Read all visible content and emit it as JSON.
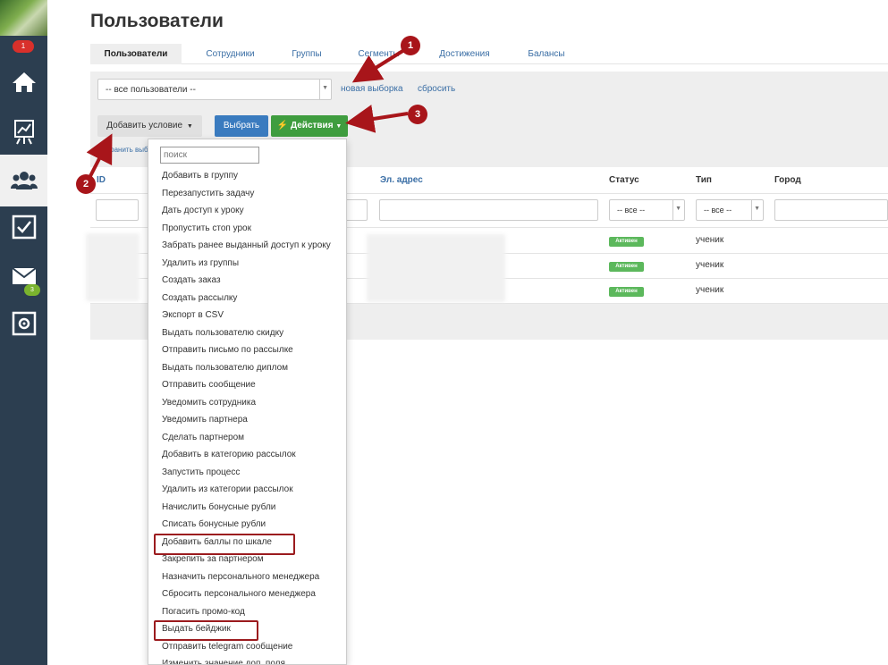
{
  "sidebar": {
    "notification_count": "1",
    "mail_count": "3",
    "items": [
      "home-icon",
      "chart-icon",
      "users-icon",
      "checkbox-icon",
      "mail-icon",
      "settings-icon"
    ]
  },
  "page_title": "Пользователи",
  "tabs": [
    "Пользователи",
    "Сотрудники",
    "Группы",
    "Сегменты",
    "Достижения",
    "Балансы"
  ],
  "filter": {
    "selection": "-- все пользователи --",
    "new_selection": "новая выборка",
    "reset": "сбросить",
    "add_condition": "Добавить условие",
    "choose": "Выбрать",
    "actions": "Действия",
    "hidden_link": "Сохранить выборку"
  },
  "table": {
    "headers": [
      "ID",
      "Эл. адрес",
      "Статус",
      "Тип",
      "Город"
    ],
    "status_filter": "-- все --",
    "type_filter": "-- все --",
    "rows": [
      {
        "status": "Активен",
        "type": "ученик"
      },
      {
        "status": "Активен",
        "type": "ученик"
      },
      {
        "status": "Активен",
        "type": "ученик"
      }
    ]
  },
  "dropdown": {
    "search_placeholder": "поиск",
    "items": [
      "Добавить в группу",
      "Перезапустить задачу",
      "Дать доступ к уроку",
      "Пропустить стоп урок",
      "Забрать ранее выданный доступ к уроку",
      "Удалить из группы",
      "Создать заказ",
      "Создать рассылку",
      "Экспорт в CSV",
      "Выдать пользователю скидку",
      "Отправить письмо по рассылке",
      "Выдать пользователю диплом",
      "Отправить сообщение",
      "Уведомить сотрудника",
      "Уведомить партнера",
      "Сделать партнером",
      "Добавить в категорию рассылок",
      "Запустить процесс",
      "Удалить из категории рассылок",
      "Начислить бонусные рубли",
      "Списать бонусные рубли",
      "Добавить баллы по шкале",
      "Закрепить за партнером",
      "Назначить персонального менеджера",
      "Сбросить персонального менеджера",
      "Погасить промо-код",
      "Выдать бейджик",
      "Отправить telegram сообщение",
      "Изменить значение доп. поля"
    ]
  },
  "annotations": [
    "1",
    "2",
    "3"
  ],
  "colors": {
    "sidebar": "#2c3e50",
    "link": "#3a6ea5",
    "primary_button": "#3a7bbf",
    "success_button": "#3f9d3f",
    "annotation": "#a8151a"
  }
}
